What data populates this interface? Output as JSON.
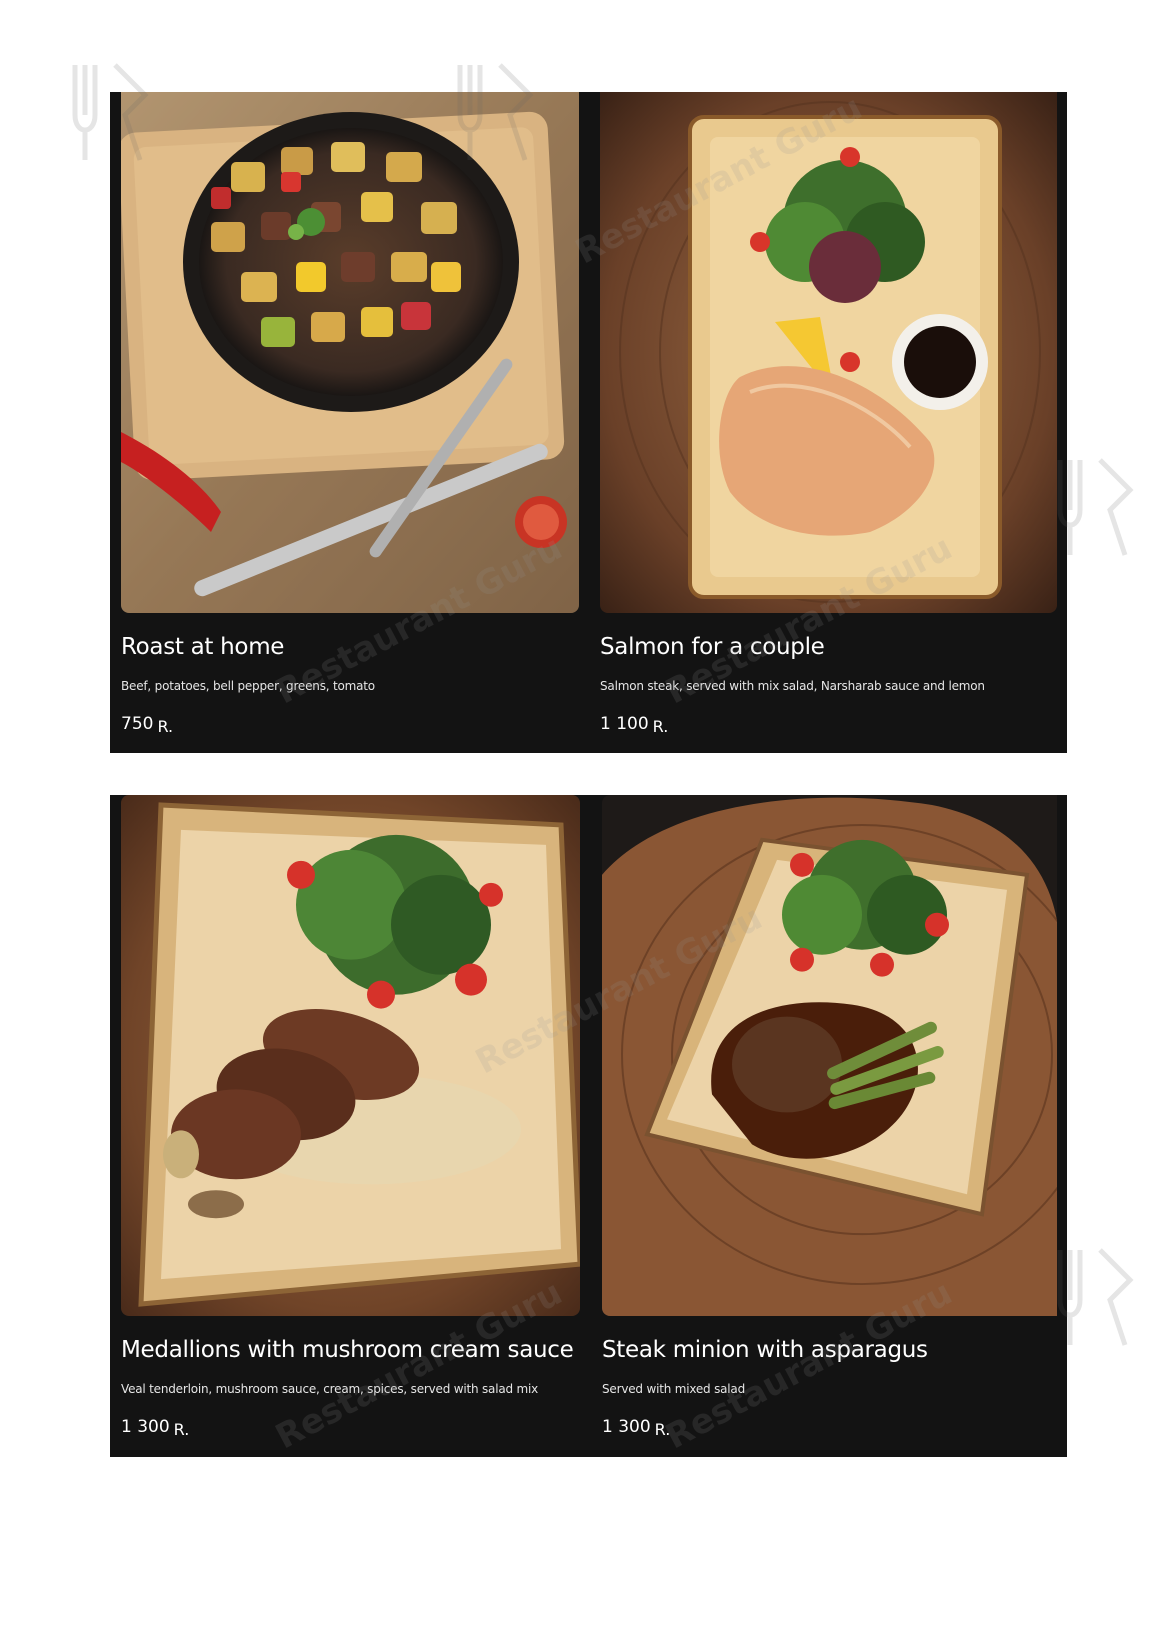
{
  "watermark_text": "Restaurant Guru",
  "currency": "R.",
  "colors": {
    "panel_background": "#131313",
    "page_background": "#ffffff",
    "text": "#ffffff"
  },
  "menu_items": [
    {
      "title": "Roast at home",
      "description": "Beef, potatoes, bell pepper, greens, tomato",
      "price": "750",
      "photo": "roast-skillet-photo"
    },
    {
      "title": "Salmon for a couple",
      "description": "Salmon steak, served with mix salad, Narsharab sauce and lemon",
      "price": "1 100",
      "photo": "salmon-plate-photo"
    },
    {
      "title": "Medallions with mushroom cream sauce",
      "description": "Veal tenderloin, mushroom sauce, cream, spices, served with salad mix",
      "price": "1 300",
      "photo": "medallions-plate-photo"
    },
    {
      "title": "Steak minion with asparagus",
      "description": "Served with mixed salad",
      "price": "1 300",
      "photo": "steak-asparagus-plate-photo"
    }
  ]
}
